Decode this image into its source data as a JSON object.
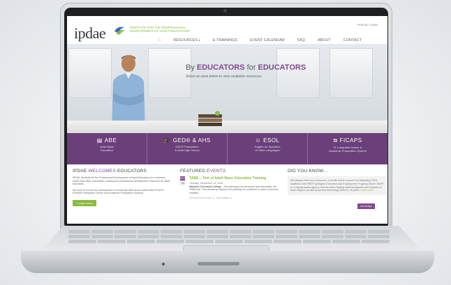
{
  "site": {
    "logo": {
      "name": "ipdae",
      "tagline": "INSTITUTE FOR THE PROFESSIONAL DEVELOPMENT OF ADULT EDUCATORS"
    },
    "portal_link": "PORTAL LOGIN",
    "nav": {
      "home_icon": "home-icon",
      "items": [
        {
          "label": "RESOURCES",
          "has_dropdown": true
        },
        {
          "label": "E-TRAININGS"
        },
        {
          "label": "EVENT CALENDAR"
        },
        {
          "label": "FAQ"
        },
        {
          "label": "ABOUT"
        },
        {
          "label": "CONTACT"
        }
      ]
    },
    "hero": {
      "title_prefix": "By ",
      "title_accent_1": "EDUCATORS",
      "title_middle": " for ",
      "title_accent_2": "EDUCATORS",
      "subtitle": "Select an area below to view available resources."
    },
    "categories": [
      {
        "icon": "book-icon",
        "title": "ABE",
        "sub1": "Adult Basic",
        "sub2": "Education"
      },
      {
        "icon": "graduation-cap-icon",
        "title": "GED® & AHS",
        "sub1": "GED® Preparation",
        "sub2": "& Adult High School"
      },
      {
        "icon": "people-icon",
        "title": "ESOL",
        "sub1": "English for Speakers",
        "sub2": "of Other Languages"
      },
      {
        "icon": "external-link-icon",
        "title": "FICAPS",
        "sub1": "FL Integrated Career &",
        "sub2": "Academic Preparation System"
      }
    ],
    "welcome": {
      "heading_prefix": "IPDAE ",
      "heading_accent": "WELCOMES",
      "heading_suffix": " EDUCATORS",
      "p1": "IPDAE (Institute for the Professional Development of Adult Educators) is a resource center that offers information, training and professional development resources for adult educators.",
      "p2": "We work to ensure the development of necessary skills and to assist with FICAPS (Florida's Integrated Career and Academic Preparation System).",
      "button": "+ Learn more"
    },
    "featured": {
      "heading_prefix": "FEATURED ",
      "heading_accent": "EVENTS",
      "event": {
        "month": "SEP",
        "day": "13",
        "title": "TABE – Test of Adult Basic Education Training",
        "date": "Tuesday, September 13, 2016",
        "body_bold": "Manatee Technical College",
        "body": " - This training is for personnel that administer the TABE test. This workshop requires the passing of a proficient in order to become certified.",
        "footer": "ORLANDO-MAITLAND, FL · SEPTEMBER 13"
      }
    },
    "did_you_know": {
      "heading": "DID YOU KNOW...",
      "text": "We always need more resources. A terrific online resource for beginning ESOL students is the REEP (Arlington Education and Employment Program) World. REEP is a Virginia based agency that has been helping adult immigrants and refugees to learn English, as well as job and technology skills for 40 years.",
      "more": "Learn more",
      "button": "see all tips"
    }
  }
}
